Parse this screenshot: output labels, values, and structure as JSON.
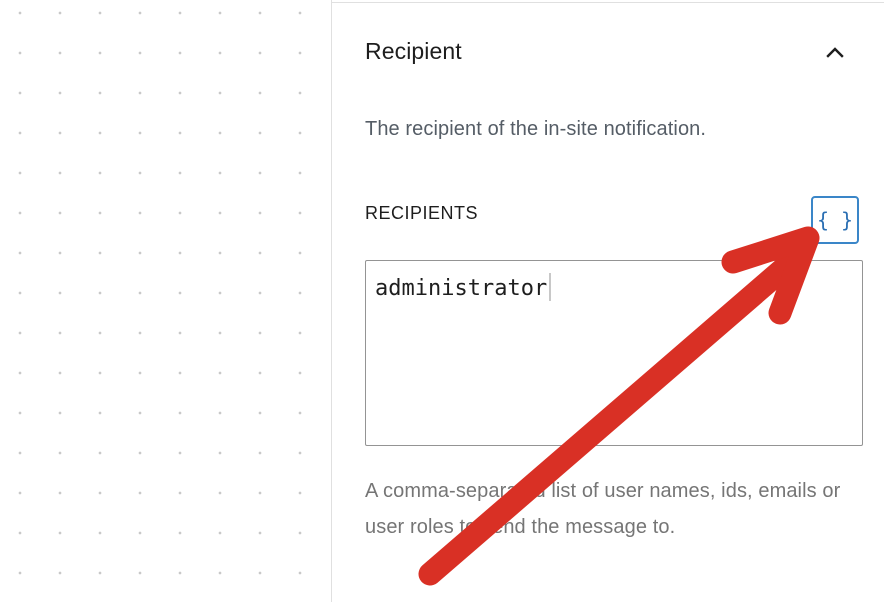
{
  "section": {
    "title": "Recipient",
    "description": "The recipient of the in-site notification."
  },
  "recipients_field": {
    "label": "RECIPIENTS",
    "value": "administrator",
    "tags_button_label": "{ }",
    "help_text": "A comma-separated list of user names, ids, emails or user roles to send the message to."
  },
  "icons": {
    "toggle": "chevron-up-icon",
    "annotation": "red-arrow"
  },
  "colors": {
    "accent": "#3a86c8",
    "annotation_arrow": "#d93025"
  }
}
